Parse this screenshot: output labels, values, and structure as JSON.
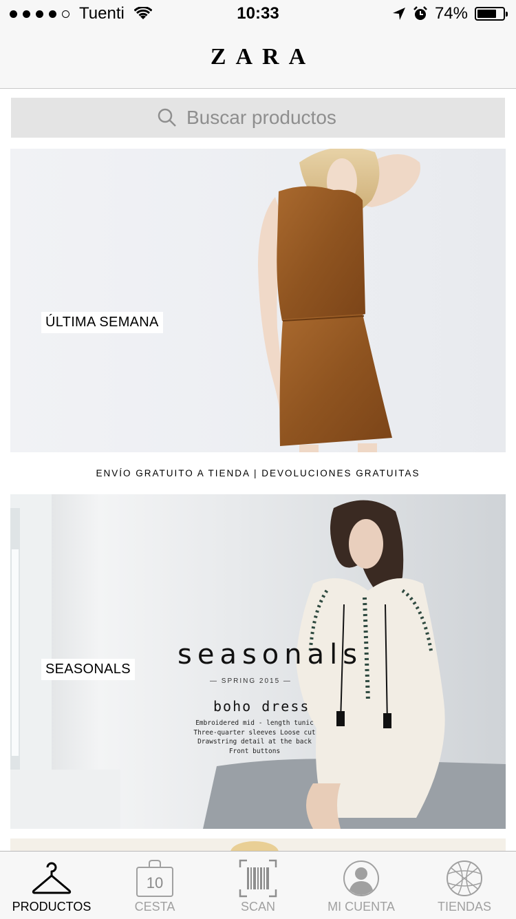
{
  "status_bar": {
    "carrier": "Tuenti",
    "time": "10:33",
    "battery_percent": "74%",
    "battery_level": 0.74
  },
  "header": {
    "logo": "ZARA"
  },
  "search": {
    "placeholder": "Buscar productos"
  },
  "banners": [
    {
      "label": "ÚLTIMA SEMANA"
    },
    {
      "label": "SEASONALS",
      "title": "seasonals",
      "subtitle": "— SPRING 2015 —",
      "product": "boho dress",
      "description": [
        "Embroidered mid - length tunic",
        "Three-quarter sleeves Loose cut",
        "Drawstring detail at the back",
        "Front buttons"
      ]
    }
  ],
  "shipping_notice": "ENVÍO GRATUITO A TIENDA | DEVOLUCIONES GRATUITAS",
  "tabbar": {
    "items": [
      {
        "label": "PRODUCTOS",
        "icon": "hanger-icon",
        "active": true
      },
      {
        "label": "CESTA",
        "icon": "bag-icon",
        "badge": "10"
      },
      {
        "label": "SCAN",
        "icon": "barcode-icon"
      },
      {
        "label": "MI CUENTA",
        "icon": "user-icon"
      },
      {
        "label": "TIENDAS",
        "icon": "globe-icon"
      }
    ]
  }
}
